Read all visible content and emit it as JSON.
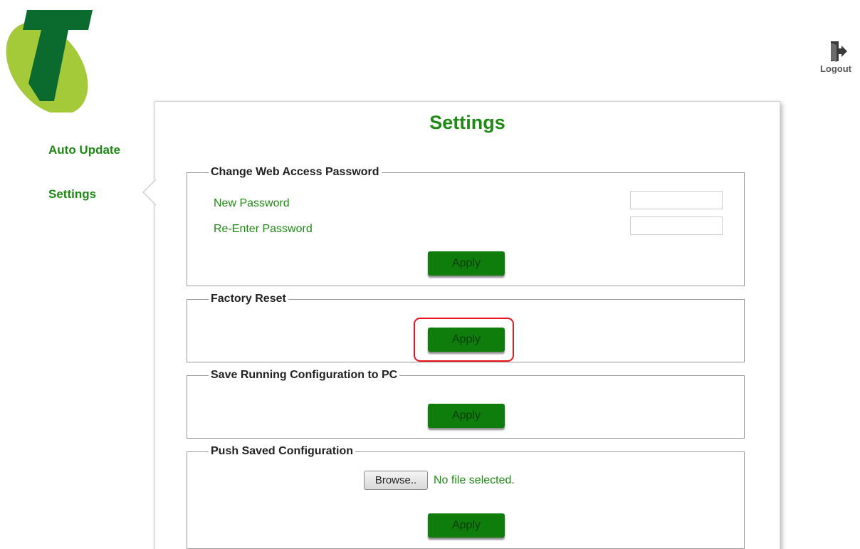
{
  "colors": {
    "brand_green": "#1e8a14",
    "button_green": "#0f7d0b",
    "highlight_red": "#e8151d",
    "logo_dark_green": "#0b6a2e",
    "logo_lime": "#a4c939"
  },
  "header": {
    "logo_icon": "telstra-t-logo",
    "logout_icon": "door-exit-icon",
    "logout_label": "Logout"
  },
  "sidebar": {
    "items": [
      {
        "label": "Auto Update"
      },
      {
        "label": "Settings"
      }
    ]
  },
  "main": {
    "title": "Settings",
    "sections": [
      {
        "legend": "Change Web Access Password",
        "fields": [
          {
            "label": "New Password",
            "value": ""
          },
          {
            "label": "Re-Enter Password",
            "value": ""
          }
        ],
        "button": "Apply"
      },
      {
        "legend": "Factory Reset",
        "button": "Apply"
      },
      {
        "legend": "Save Running Configuration to PC",
        "button": "Apply"
      },
      {
        "legend": "Push Saved Configuration",
        "browse_label": "Browse..",
        "file_status": "No file selected.",
        "button": "Apply"
      }
    ]
  }
}
